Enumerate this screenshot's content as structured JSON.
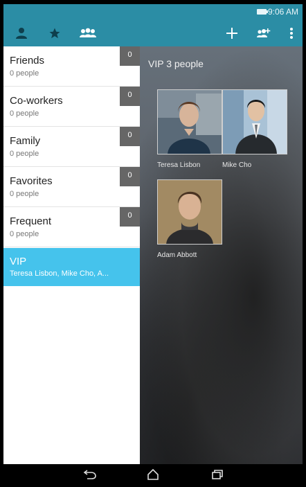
{
  "status_bar": {
    "time": "9:06 AM"
  },
  "app_bar": {
    "tabs": [
      {
        "name": "contacts-tab",
        "icon": "person-icon"
      },
      {
        "name": "favorites-tab",
        "icon": "star-icon"
      },
      {
        "name": "groups-tab",
        "icon": "group-icon"
      }
    ],
    "actions": [
      {
        "name": "add-button",
        "icon": "plus-icon"
      },
      {
        "name": "add-member-button",
        "icon": "add-group-icon"
      },
      {
        "name": "more-button",
        "icon": "overflow-menu-icon"
      }
    ],
    "accent": "#2b8da5"
  },
  "groups": [
    {
      "name": "Friends",
      "subtitle": "0 people",
      "count": "0"
    },
    {
      "name": "Co-workers",
      "subtitle": "0 people",
      "count": "0"
    },
    {
      "name": "Family",
      "subtitle": "0 people",
      "count": "0"
    },
    {
      "name": "Favorites",
      "subtitle": "0 people",
      "count": "0"
    },
    {
      "name": "Frequent",
      "subtitle": "0 people",
      "count": "0"
    },
    {
      "name": "VIP",
      "subtitle": "Teresa Lisbon, Mike Cho, A..."
    }
  ],
  "selected_color": "#45c3ec",
  "detail": {
    "header": "VIP 3 people",
    "members": [
      {
        "name": "Teresa Lisbon"
      },
      {
        "name": "Mike Cho"
      },
      {
        "name": "Adam Abbott"
      }
    ]
  },
  "nav_bar": [
    {
      "name": "back-button",
      "icon": "back-icon"
    },
    {
      "name": "home-button",
      "icon": "home-icon"
    },
    {
      "name": "recents-button",
      "icon": "recents-icon"
    }
  ]
}
